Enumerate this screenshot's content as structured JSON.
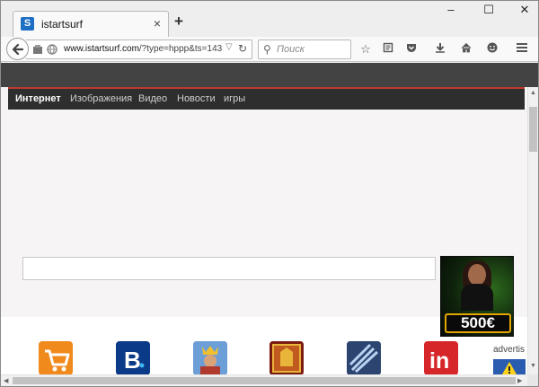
{
  "browser": {
    "tab": {
      "favicon_letter": "S",
      "title": "istartsurf",
      "close_glyph": "×"
    },
    "new_tab_glyph": "+",
    "window_controls": {
      "minimize": "–",
      "maximize": "☐",
      "close": "✕"
    },
    "url": {
      "domain": "www.istartsurf.com",
      "path": "/?type=hppp&ts=143"
    },
    "search_placeholder": "Поиск",
    "toolbar_icons": [
      "star-icon",
      "reading-list-icon",
      "pocket-icon",
      "download-icon",
      "home-icon",
      "smiley-icon",
      "menu-icon"
    ]
  },
  "site": {
    "menu": [
      "Интернет",
      "Изображения",
      "Видео",
      "Новости",
      "игры"
    ],
    "ad": {
      "prize": "500€"
    },
    "ad_label": "advertis",
    "apps": [
      {
        "name": "shopping-cart-app-icon",
        "color": "#f08a1c"
      },
      {
        "name": "booking-app-icon",
        "color": "#0a3a88"
      },
      {
        "name": "game-knight-app-icon",
        "color": "#3d7ac9"
      },
      {
        "name": "game-castle-app-icon",
        "color": "#9b1d15"
      },
      {
        "name": "game-sword-app-icon",
        "color": "#3c5a8c"
      },
      {
        "name": "linkedin-app-icon",
        "color": "#d6262a"
      }
    ]
  }
}
